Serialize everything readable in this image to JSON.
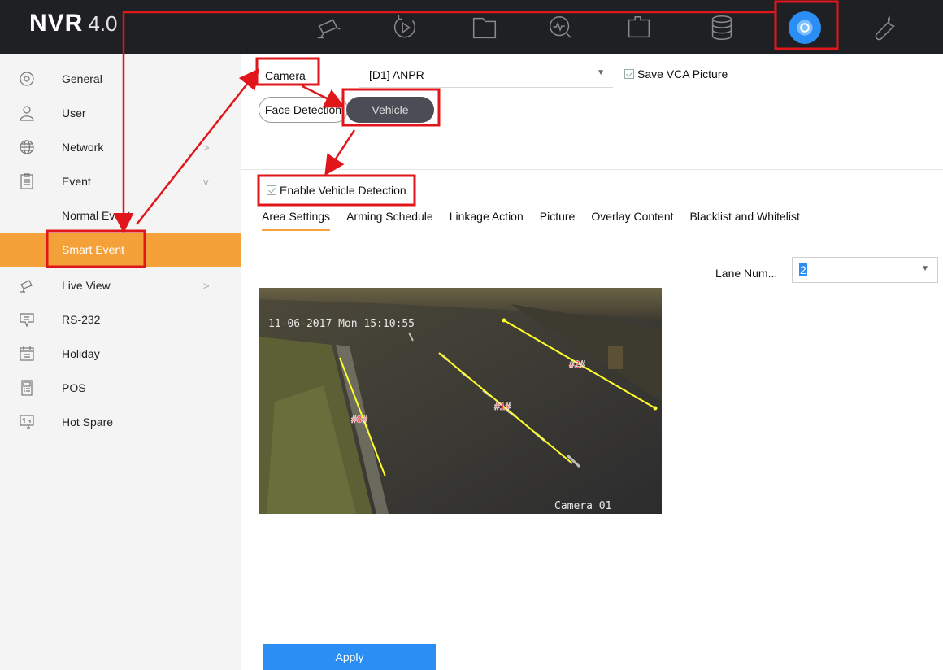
{
  "app": {
    "logo_text": "NVR",
    "logo_version": "4.0"
  },
  "topbar": {
    "icons": [
      "live-view-camera-icon",
      "playback-icon",
      "file-folder-icon",
      "smart-analysis-icon",
      "map-icon",
      "storage-icon",
      "configuration-gear-icon",
      "maintenance-wrench-icon"
    ],
    "active": "configuration-gear-icon"
  },
  "sidebar": {
    "items": [
      {
        "label": "General",
        "icon": "general-icon"
      },
      {
        "label": "User",
        "icon": "user-icon"
      },
      {
        "label": "Network",
        "icon": "network-globe-icon",
        "chevron": ">"
      },
      {
        "label": "Event",
        "icon": "event-icon",
        "chevron": "v"
      },
      {
        "label": "Normal Event"
      },
      {
        "label": "Smart Event",
        "active": true
      },
      {
        "label": "Live View",
        "icon": "live-view-icon",
        "chevron": ">"
      },
      {
        "label": "RS-232",
        "icon": "rs232-icon"
      },
      {
        "label": "Holiday",
        "icon": "holiday-calendar-icon"
      },
      {
        "label": "POS",
        "icon": "pos-icon"
      },
      {
        "label": "Hot Spare",
        "icon": "hot-spare-icon"
      }
    ]
  },
  "main": {
    "camera_label": "Camera",
    "camera_value": "[D1] ANPR",
    "save_vca_label": "Save VCA Picture",
    "detection_modes": {
      "face": "Face Detection",
      "vehicle": "Vehicle"
    },
    "enable_label": "Enable Vehicle Detection",
    "tabs": [
      "Area Settings",
      "Arming Schedule",
      "Linkage Action",
      "Picture",
      "Overlay Content",
      "Blacklist and Whitelist"
    ],
    "active_tab": "Area Settings",
    "lane_num_label": "Lane Num...",
    "lane_num_value": "2",
    "video": {
      "timestamp": "11-06-2017 Mon 15:10:55",
      "camera_name": "Camera 01",
      "lanes": [
        "#0#",
        "#1#",
        "#2#"
      ]
    },
    "apply_label": "Apply"
  },
  "colors": {
    "topbar_bg": "#1f2023",
    "accent_orange": "#f5a13a",
    "accent_blue": "#2a8ef5",
    "annotation_red": "#e0161b",
    "lane_line": "#ffff2a"
  }
}
